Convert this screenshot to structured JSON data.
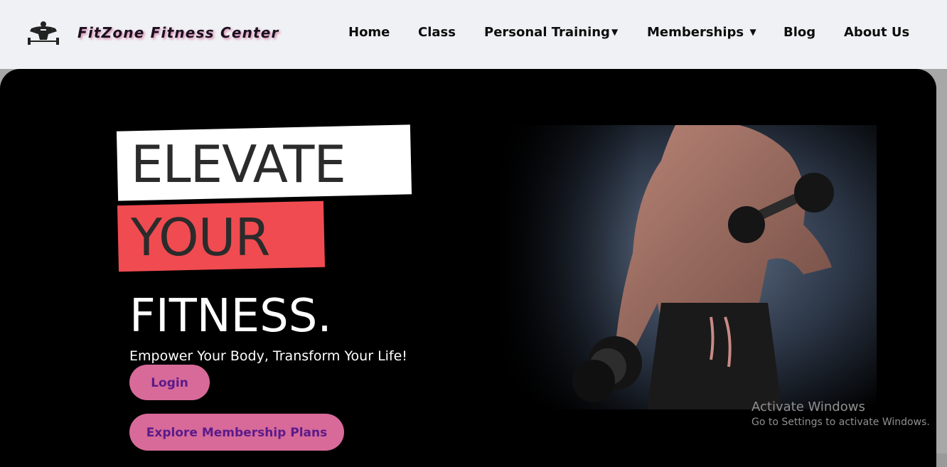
{
  "header": {
    "brand": "FitZone Fitness Center",
    "logo_icon": "bodybuilder-barbell-icon",
    "nav": [
      {
        "label": "Home",
        "caret": false
      },
      {
        "label": "Class",
        "caret": false
      },
      {
        "label": "Personal Training",
        "caret": true
      },
      {
        "label": "Memberships",
        "caret": true
      },
      {
        "label": "Blog",
        "caret": false
      },
      {
        "label": "About Us",
        "caret": false
      }
    ],
    "caret_glyph": "▼"
  },
  "hero": {
    "line1": "ELEVATE",
    "line2": "YOUR",
    "line3": "FITNESS.",
    "tagline": "Empower Your Body, Transform Your Life!",
    "login_label": "Login",
    "explore_label": "Explore Membership Plans",
    "image": "muscular man lifting dumbbells"
  },
  "watermark": {
    "title": "Activate Windows",
    "subtitle": "Go to Settings to activate Windows."
  },
  "colors": {
    "nav_bg": "#f0f1f4",
    "hero_bg": "#000000",
    "accent_red": "#f04b50",
    "button_pink": "#d86a99",
    "button_text": "#5a1a8a"
  }
}
